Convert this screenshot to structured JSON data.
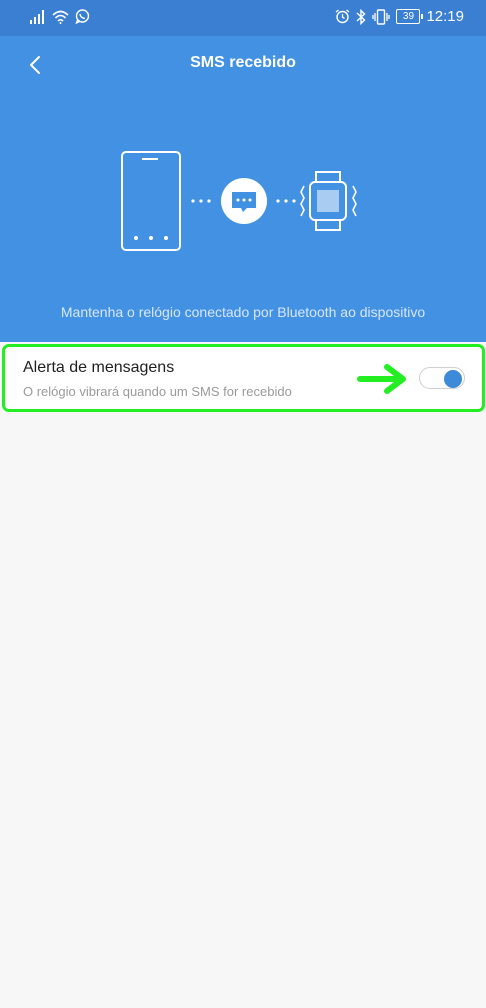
{
  "status_bar": {
    "time": "12:19",
    "battery": "39",
    "icons": [
      "signal-icon",
      "wifi-icon",
      "whatsapp-icon",
      "alarm-icon",
      "bluetooth-icon",
      "vibrate-icon",
      "battery-icon"
    ]
  },
  "header": {
    "title": "SMS recebido",
    "back_icon": "chevron-left-icon",
    "caption": "Mantenha o relógio conectado por Bluetooth ao dispositivo",
    "illustration_icons": [
      "phone-icon",
      "message-bubble-icon",
      "watch-icon"
    ]
  },
  "setting": {
    "title": "Alerta de mensagens",
    "subtitle": "O relógio vibrará quando um SMS for recebido",
    "toggle_on": true,
    "highlight_color": "#22ee22",
    "annotation_icon": "arrow-right-icon"
  },
  "colors": {
    "status_bar": "#3a7fd1",
    "header": "#4391e2",
    "background": "#f7f7f7",
    "toggle_accent": "#3d8ad9",
    "annotation_green": "#22ee22"
  }
}
